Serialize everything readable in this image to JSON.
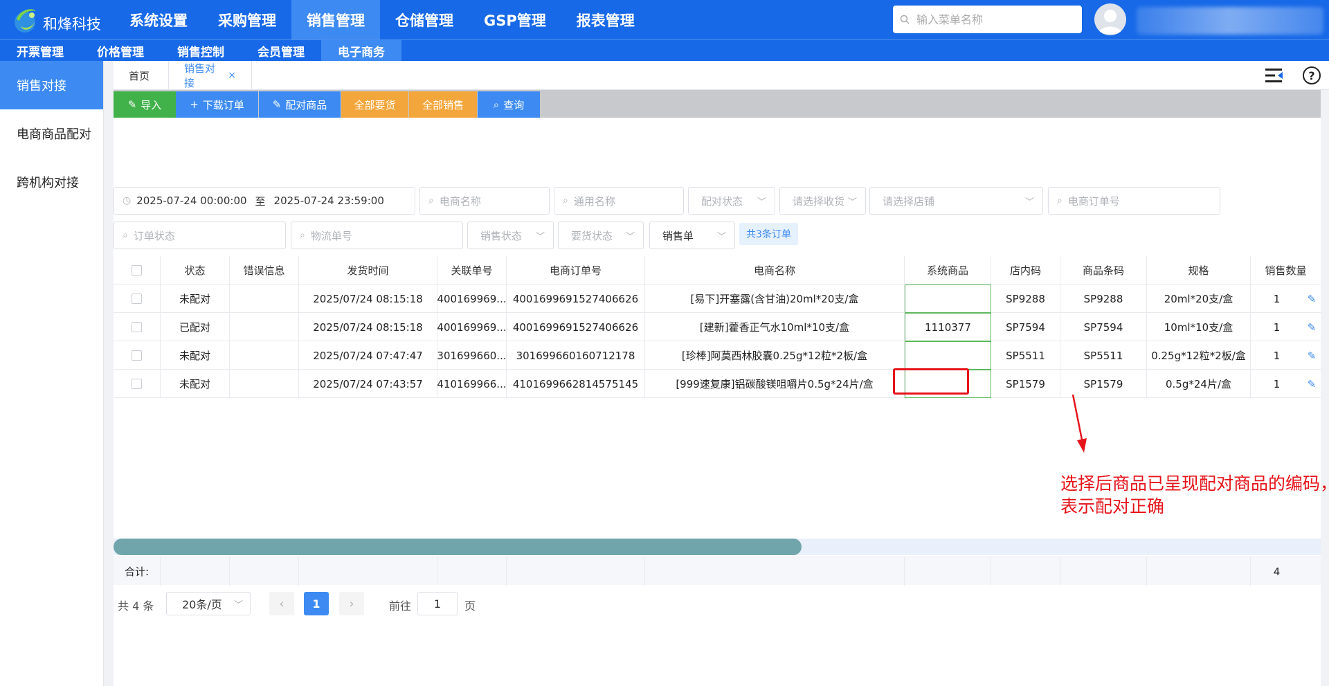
{
  "brand": {
    "name": "和烽科技"
  },
  "topnav": [
    {
      "label": "系统设置"
    },
    {
      "label": "采购管理"
    },
    {
      "label": "销售管理",
      "active": true
    },
    {
      "label": "仓储管理"
    },
    {
      "label": "GSP管理"
    },
    {
      "label": "报表管理"
    }
  ],
  "search": {
    "placeholder": "输入菜单名称"
  },
  "subnav": [
    {
      "label": "开票管理"
    },
    {
      "label": "价格管理"
    },
    {
      "label": "销售控制"
    },
    {
      "label": "会员管理"
    },
    {
      "label": "电子商务",
      "active": true
    }
  ],
  "sidebar": [
    {
      "label": "销售对接",
      "active": true
    },
    {
      "label": "电商商品配对"
    },
    {
      "label": "跨机构对接"
    }
  ],
  "tabs": {
    "home": "首页",
    "current": "销售对接",
    "close": "×"
  },
  "toolbar": {
    "import": "导入",
    "download": "下载订单",
    "match": "配对商品",
    "all_request": "全部要货",
    "all_sale": "全部销售",
    "query": "查询"
  },
  "filters": {
    "date_start": "2025-07-24 00:00:00",
    "date_sep": "至",
    "date_end": "2025-07-24 23:59:00",
    "ec_name": "电商名称",
    "common_name": "通用名称",
    "match_status": "配对状态",
    "receiver": "请选择收货",
    "store": "请选择店铺",
    "ec_order_no": "电商订单号",
    "order_status": "订单状态",
    "logistics_no": "物流单号",
    "sale_status": "销售状态",
    "request_status": "要货状态",
    "doc_type": "销售单",
    "count_badge": "共3条订单"
  },
  "table": {
    "headers": [
      "状态",
      "错误信息",
      "发货时间",
      "关联单号",
      "电商订单号",
      "电商名称",
      "系统商品",
      "店内码",
      "商品条码",
      "规格",
      "销售数量"
    ],
    "rows": [
      {
        "status": "未配对",
        "error": "",
        "ship_time": "2025/07/24 08:15:18",
        "rel_no": "400169969...",
        "ec_order": "4001699691527406626",
        "ec_name": "[易下]开塞露(含甘油)20ml*20支/盒",
        "sys_item": "",
        "store_code": "SP9288",
        "barcode": "SP9288",
        "spec": "20ml*20支/盒",
        "qty": "1"
      },
      {
        "status": "已配对",
        "error": "",
        "ship_time": "2025/07/24 08:15:18",
        "rel_no": "400169969...",
        "ec_order": "4001699691527406626",
        "ec_name": "[建新]藿香正气水10ml*10支/盒",
        "sys_item": "1110377",
        "store_code": "SP7594",
        "barcode": "SP7594",
        "spec": "10ml*10支/盒",
        "qty": "1"
      },
      {
        "status": "未配对",
        "error": "",
        "ship_time": "2025/07/24 07:47:47",
        "rel_no": "301699660...",
        "ec_order": "301699660160712178",
        "ec_name": "[珍棒]阿莫西林胶囊0.25g*12粒*2板/盒",
        "sys_item": "",
        "store_code": "SP5511",
        "barcode": "SP5511",
        "spec": "0.25g*12粒*2板/盒",
        "qty": "1"
      },
      {
        "status": "未配对",
        "error": "",
        "ship_time": "2025/07/24 07:43:57",
        "rel_no": "410169966...",
        "ec_order": "4101699662814575145",
        "ec_name": "[999速复康]铝碳酸镁咀嚼片0.5g*24片/盒",
        "sys_item": "",
        "store_code": "SP1579",
        "barcode": "SP1579",
        "spec": "0.5g*24片/盒",
        "qty": "1"
      }
    ],
    "summary_label": "合计:",
    "summary_qty": "4",
    "horizontal_scroll_fraction": 0.57
  },
  "annotation": {
    "line1": "选择后商品已呈现配对商品的编码，",
    "line2": "表示配对正确",
    "color": "#e5141a"
  },
  "pagination": {
    "total": "共 4 条",
    "page_size": "20条/页",
    "prev": "‹",
    "current": "1",
    "next": "›",
    "goto": "前往",
    "goto_value": "1",
    "page_unit": "页"
  },
  "colors": {
    "primary": "#1769e8",
    "active": "#3d8bf2",
    "green": "#41b14a",
    "orange": "#f3a63b"
  }
}
